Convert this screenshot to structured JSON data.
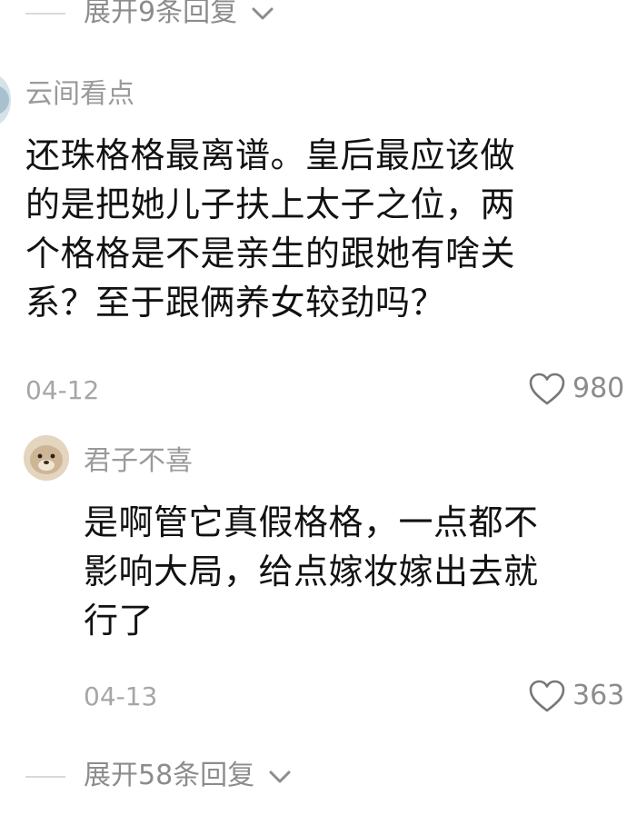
{
  "top_expand": {
    "label": "展开9条回复",
    "icon": "chevron-down-icon"
  },
  "comment": {
    "username": "云间看点",
    "lines": [
      "还珠格格最离谱。皇后最应该做",
      "的是把她儿子扶上太子之位，两",
      "个格格是不是亲生的跟她有啥关",
      "系？至于跟俩养女较劲吗？"
    ],
    "date": "04-12",
    "likes": "980",
    "like_icon": "heart-icon"
  },
  "reply": {
    "username": "君子不喜",
    "lines": [
      "是啊管它真假格格，一点都不",
      "影响大局，给点嫁妆嫁出去就",
      "行了"
    ],
    "date": "04-13",
    "likes": "363",
    "like_icon": "heart-icon"
  },
  "bottom_expand": {
    "label": "展开58条回复",
    "icon": "chevron-down-icon"
  }
}
